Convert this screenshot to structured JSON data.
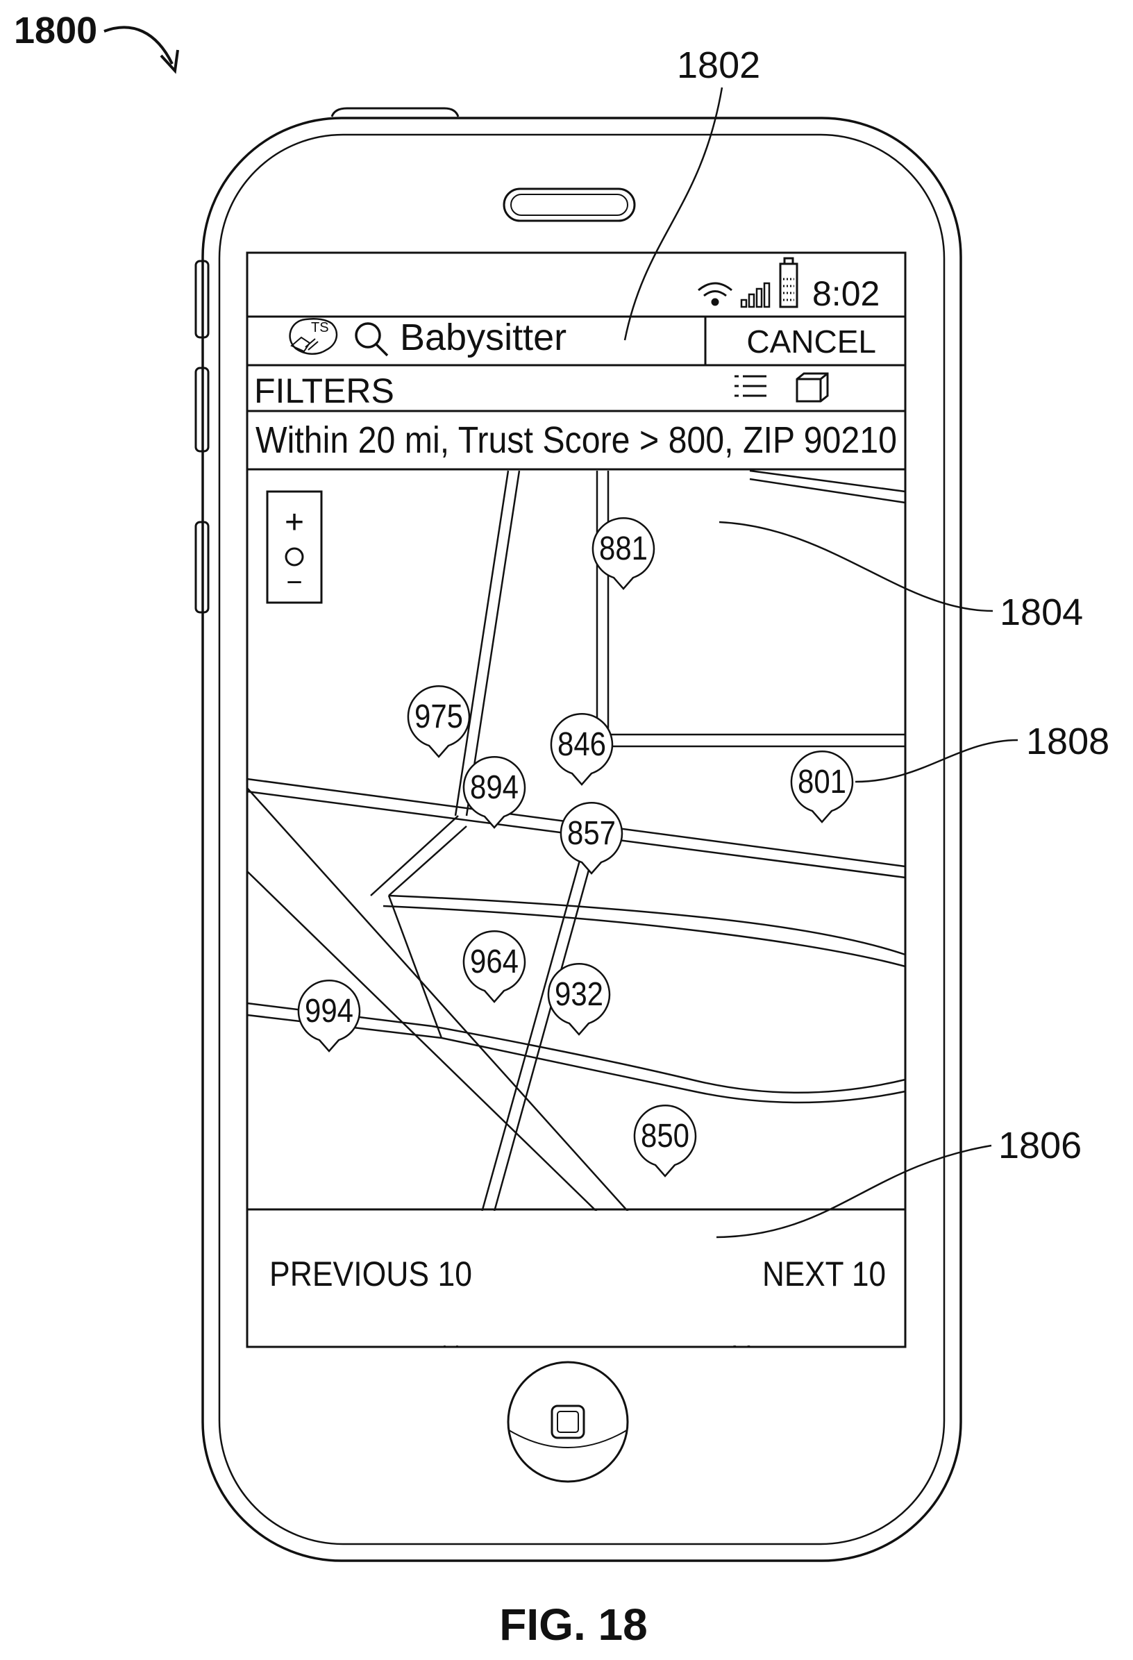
{
  "figure": {
    "number_label": "1800",
    "caption": "FIG. 18",
    "callouts": {
      "search_bar": "1802",
      "map": "1804",
      "pagination": "1806",
      "pin": "1808"
    }
  },
  "status_bar": {
    "time": "8:02"
  },
  "search": {
    "logo_text": "TS",
    "query": "Babysitter",
    "cancel_label": "CANCEL"
  },
  "filters": {
    "title": "FILTERS",
    "summary": "Within 20 mi, Trust Score > 800, ZIP 90210"
  },
  "map": {
    "zoom_in": "+",
    "zoom_out": "−",
    "pins": [
      {
        "score": "881"
      },
      {
        "score": "975"
      },
      {
        "score": "846"
      },
      {
        "score": "801"
      },
      {
        "score": "894"
      },
      {
        "score": "857"
      },
      {
        "score": "964"
      },
      {
        "score": "932"
      },
      {
        "score": "994"
      },
      {
        "score": "850"
      }
    ]
  },
  "pagination": {
    "previous_label": "PREVIOUS 10",
    "next_label": "NEXT 10"
  },
  "colors": {
    "ink": "#111111",
    "paper": "#ffffff"
  }
}
